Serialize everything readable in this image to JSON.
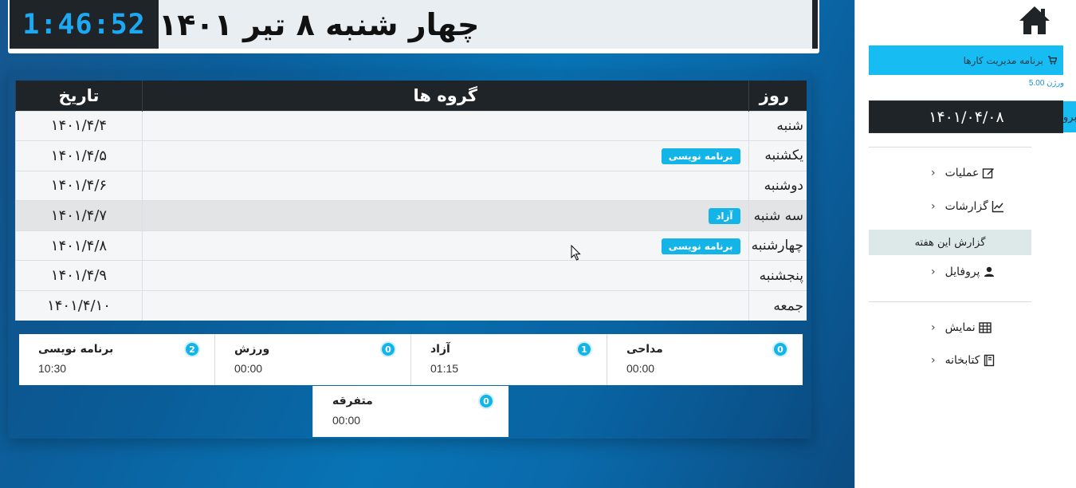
{
  "header": {
    "clock": "1:46:52",
    "date_title": "چهار شنبه ۸ تیر ۱۴۰۱"
  },
  "week_table": {
    "headers": {
      "day": "روز",
      "groups": "گروه ها",
      "date": "تاریخ"
    },
    "rows": [
      {
        "day": "شنبه",
        "tag": "",
        "date": "۱۴۰۱/۴/۴"
      },
      {
        "day": "یکشنبه",
        "tag": "برنامه نویسی",
        "date": "۱۴۰۱/۴/۵"
      },
      {
        "day": "دوشنبه",
        "tag": "",
        "date": "۱۴۰۱/۴/۶"
      },
      {
        "day": "سه شنبه",
        "tag": "آزاد",
        "date": "۱۴۰۱/۴/۷"
      },
      {
        "day": "چهارشنبه",
        "tag": "برنامه نویسی",
        "date": "۱۴۰۱/۴/۸"
      },
      {
        "day": "پنجشنبه",
        "tag": "",
        "date": "۱۴۰۱/۴/۹"
      },
      {
        "day": "جمعه",
        "tag": "",
        "date": "۱۴۰۱/۴/۱۰"
      }
    ]
  },
  "summary": [
    {
      "name": "مداحی",
      "count": "0",
      "time": "00:00"
    },
    {
      "name": "آزاد",
      "count": "1",
      "time": "01:15"
    },
    {
      "name": "ورزش",
      "count": "0",
      "time": "00:00"
    },
    {
      "name": "برنامه نویسی",
      "count": "2",
      "time": "10:30"
    }
  ],
  "summary_extra": {
    "name": "متفرقه",
    "count": "0",
    "time": "00:00"
  },
  "sidebar": {
    "app_title": "برنامه مدیریت کارها",
    "version": "ورژن 5.00",
    "date_value": "۱۴۰۱/۰۴/۰۸",
    "go_label": "برو",
    "nav": {
      "operations": "عملیات",
      "reports": "گزارشات",
      "report_week": "گزارش این هفته",
      "profile": "پروفایل",
      "display": "نمایش",
      "library": "کتابخانه"
    }
  },
  "colors": {
    "accent": "#13b4e8",
    "dark": "#1f2428",
    "clock_text": "#1da9f2"
  }
}
